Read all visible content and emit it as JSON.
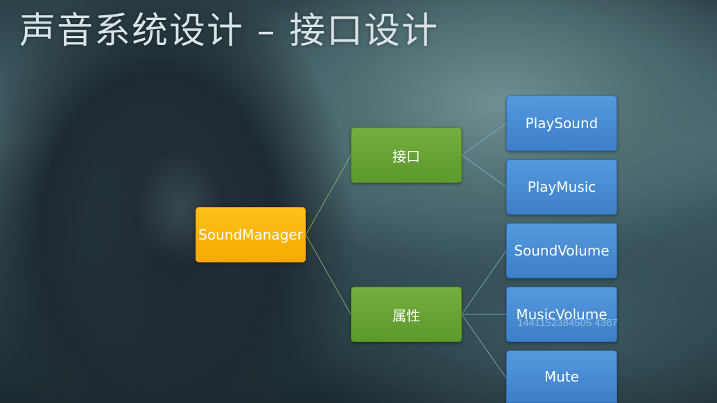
{
  "title": "声音系统设计 – 接口设计",
  "diagram": {
    "root": {
      "label": "SoundManager",
      "color": "#f5a900"
    },
    "branches": [
      {
        "label": "接口",
        "color": "#5c9a2c",
        "children": [
          "PlaySound",
          "PlayMusic"
        ]
      },
      {
        "label": "属性",
        "color": "#5c9a2c",
        "children": [
          "SoundVolume",
          "MusicVolume",
          "Mute"
        ]
      }
    ],
    "leaf_color": "#3d7fc9"
  },
  "watermark": "1441152384505 4367"
}
